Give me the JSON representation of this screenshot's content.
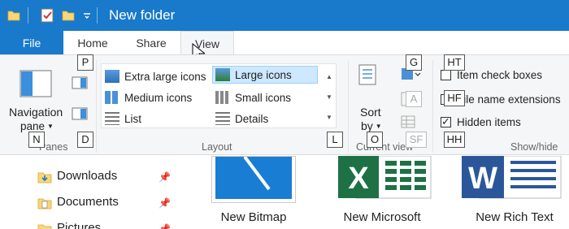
{
  "window": {
    "title": "New folder"
  },
  "tabs": {
    "file": "File",
    "home": "Home",
    "share": "Share",
    "view": "View"
  },
  "ribbon": {
    "panes": {
      "navigation_pane_line1": "Navigation",
      "navigation_pane_line2": "pane",
      "label": "Panes"
    },
    "layout": {
      "label": "Layout",
      "items": {
        "extra_large": "Extra large icons",
        "large": "Large icons",
        "medium": "Medium icons",
        "small": "Small icons",
        "list": "List",
        "details": "Details"
      }
    },
    "current_view": {
      "sort_line1": "Sort",
      "sort_line2": "by",
      "label": "Current view"
    },
    "show_hide": {
      "item_check_boxes": "Item check boxes",
      "file_name_extensions": "File name extensions",
      "hidden_items": "Hidden items",
      "hidden_items_checked": true,
      "label": "Show/hide"
    }
  },
  "keytips": {
    "p": "P",
    "n": "N",
    "d": "D",
    "l": "L",
    "g": "G",
    "o": "O",
    "ht": "HT",
    "hf": "HF",
    "hh": "HH",
    "a": "A",
    "sf": "SF"
  },
  "nav": {
    "downloads": "Downloads",
    "documents": "Documents",
    "pictures": "Pictures"
  },
  "files": {
    "bitmap": "New Bitmap",
    "excel": "New Microsoft",
    "rtf": "New Rich Text"
  },
  "colors": {
    "title_bar": "#1979ca",
    "selected_bg": "#cde8ff",
    "excel": "#1e7145",
    "word": "#2b579a"
  }
}
